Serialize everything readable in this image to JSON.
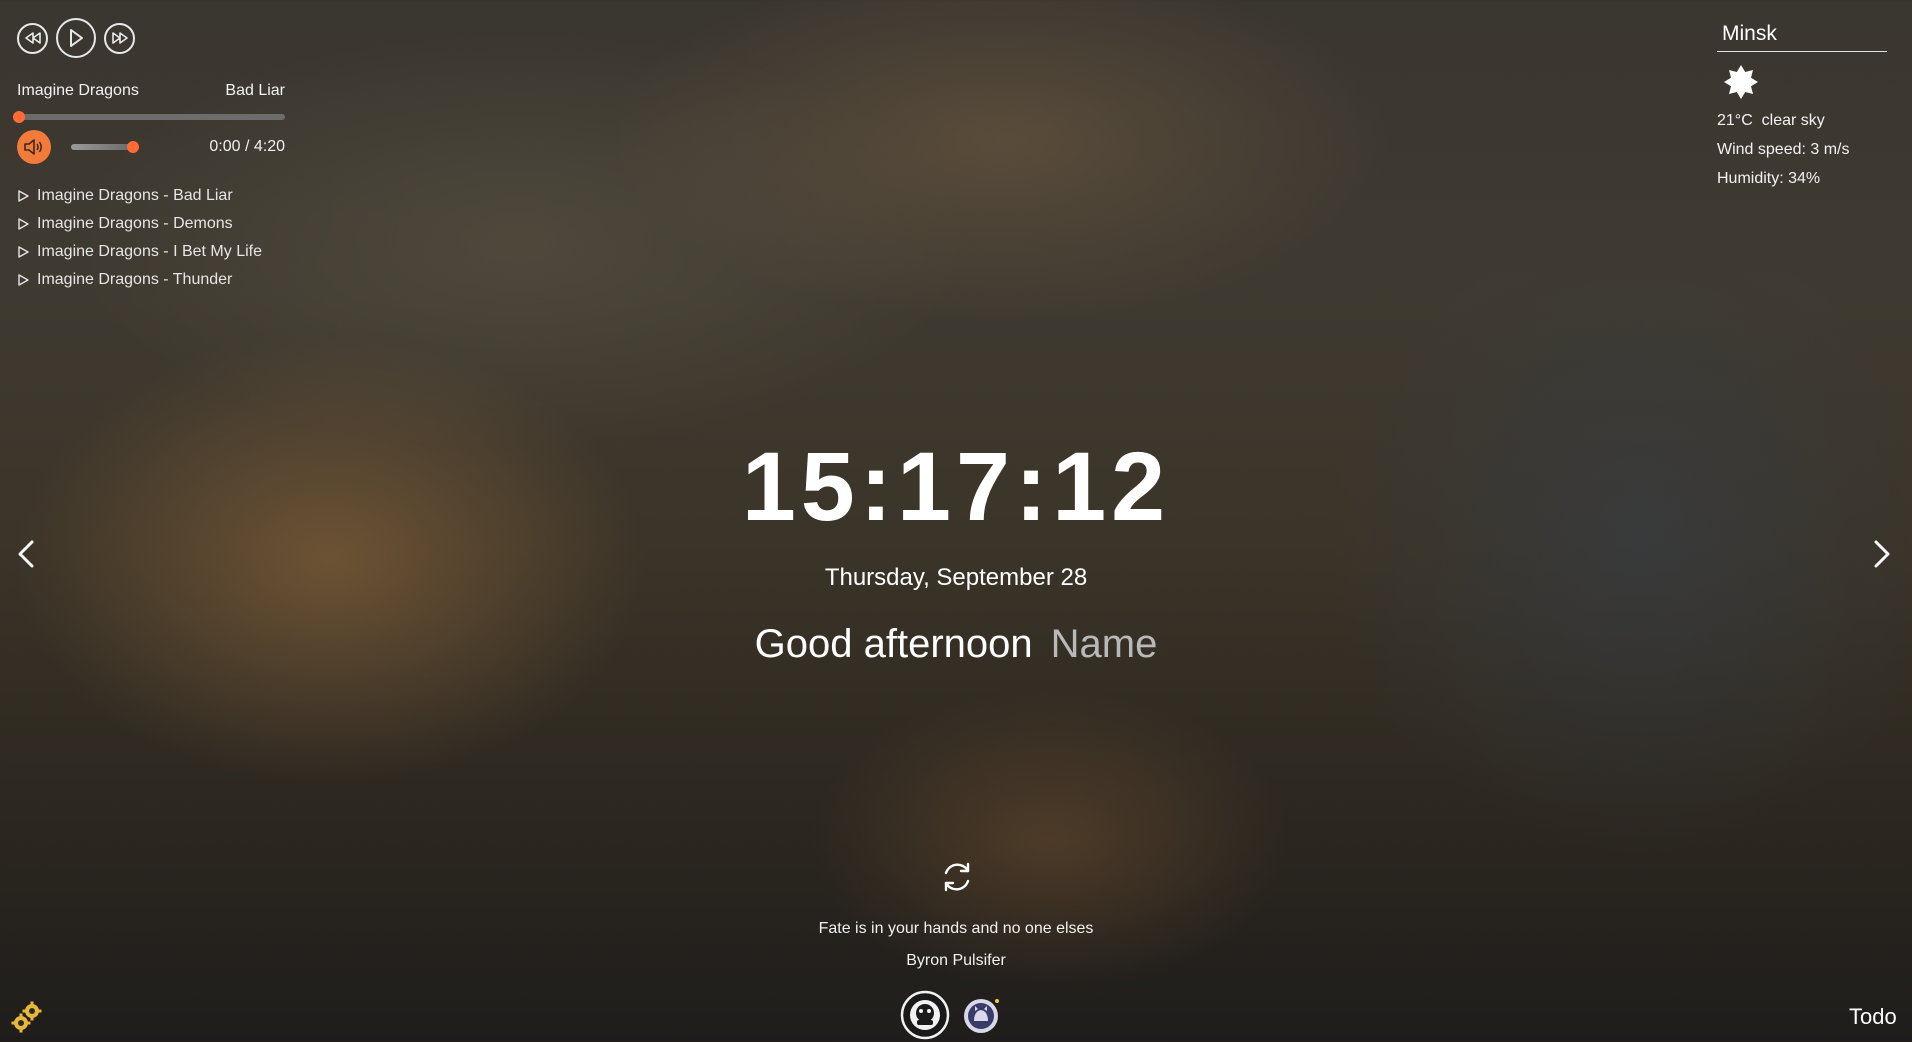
{
  "player": {
    "controls": {
      "prev_icon": "rewind-icon",
      "play_icon": "play-icon",
      "next_icon": "fast-forward-icon"
    },
    "artist": "Imagine Dragons",
    "title": "Bad Liar",
    "progress": 0,
    "volume_icon": "speaker-icon",
    "volume": 0.8,
    "time": "0:00 / 4:20",
    "playlist": [
      "Imagine Dragons - Bad Liar",
      "Imagine Dragons - Demons",
      "Imagine Dragons - I Bet My Life",
      "Imagine Dragons - Thunder"
    ],
    "accent_color": "#ff6b35"
  },
  "weather": {
    "city": "Minsk",
    "icon": "clear-sky-sun-icon",
    "temperature": "21°C",
    "description": "clear sky",
    "wind": "Wind speed: 3 m/s",
    "humidity": "Humidity: 34%"
  },
  "clock": {
    "time": "15:17:12",
    "date": "Thursday, September 28"
  },
  "greeting": {
    "text": "Good afternoon",
    "name_placeholder": "Name"
  },
  "slider": {
    "prev_icon": "chevron-left-icon",
    "next_icon": "chevron-right-icon"
  },
  "quote": {
    "refresh_icon": "refresh-icon",
    "text": "Fate is in your hands and no one elses",
    "author": "Byron Pulsifer"
  },
  "footer": {
    "logos": [
      "rs-school-logo",
      "github-icon"
    ],
    "settings_icon": "gears-icon",
    "todo_label": "Todo"
  }
}
